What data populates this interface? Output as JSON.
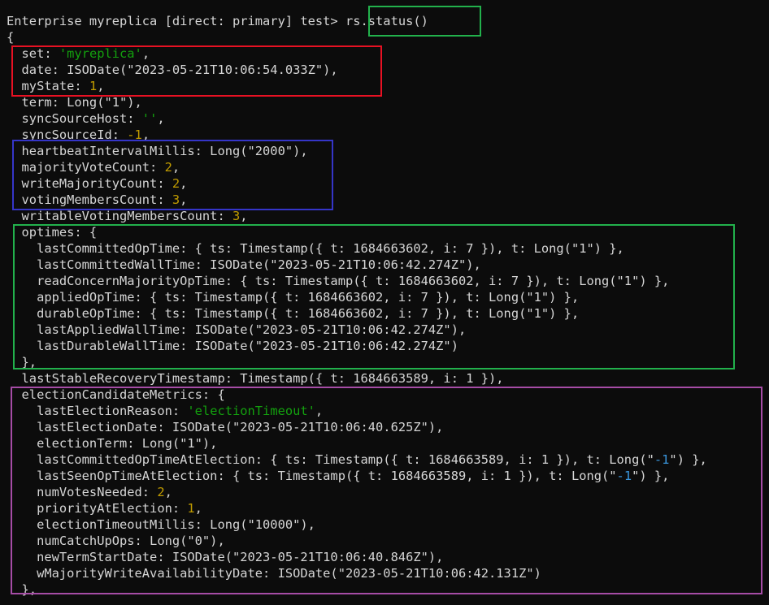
{
  "prompt": {
    "text": "Enterprise myreplica [direct: primary] test> ",
    "command": "rs.status()"
  },
  "highlight_colors": {
    "green": "#22b14c",
    "red": "#e81123",
    "blue": "#3535c8",
    "purple": "#a64ca6"
  },
  "output": {
    "open_brace": "{",
    "set_key": "  set: ",
    "set_val": "'myreplica'",
    "set_end": ",",
    "date": "  date: ISODate(\"2023-05-21T10:06:54.033Z\"),",
    "myState_key": "  myState: ",
    "myState_val": "1",
    "myState_end": ",",
    "term": "  term: Long(\"1\"),",
    "syncSourceHost_key": "  syncSourceHost: ",
    "syncSourceHost_val": "''",
    "syncSourceHost_end": ",",
    "syncSourceId_key": "  syncSourceId: ",
    "syncSourceId_val": "-1",
    "syncSourceId_end": ",",
    "heartbeat": "  heartbeatIntervalMillis: Long(\"2000\"),",
    "majorityVoteCount_key": "  majorityVoteCount: ",
    "majorityVoteCount_val": "2",
    "majorityVoteCount_end": ",",
    "writeMajorityCount_key": "  writeMajorityCount: ",
    "writeMajorityCount_val": "2",
    "writeMajorityCount_end": ",",
    "votingMembersCount_key": "  votingMembersCount: ",
    "votingMembersCount_val": "3",
    "votingMembersCount_end": ",",
    "writableVotingMembersCount_key": "  writableVotingMembersCount: ",
    "writableVotingMembersCount_val": "3",
    "writableVotingMembersCount_end": ",",
    "optimes_open": "  optimes: {",
    "optimes_lines": [
      "    lastCommittedOpTime: { ts: Timestamp({ t: 1684663602, i: 7 }), t: Long(\"1\") },",
      "    lastCommittedWallTime: ISODate(\"2023-05-21T10:06:42.274Z\"),",
      "    readConcernMajorityOpTime: { ts: Timestamp({ t: 1684663602, i: 7 }), t: Long(\"1\") },",
      "    appliedOpTime: { ts: Timestamp({ t: 1684663602, i: 7 }), t: Long(\"1\") },",
      "    durableOpTime: { ts: Timestamp({ t: 1684663602, i: 7 }), t: Long(\"1\") },",
      "    lastAppliedWallTime: ISODate(\"2023-05-21T10:06:42.274Z\"),",
      "    lastDurableWallTime: ISODate(\"2023-05-21T10:06:42.274Z\")"
    ],
    "optimes_close": "  },",
    "lastStableRecovery": "  lastStableRecoveryTimestamp: Timestamp({ t: 1684663589, i: 1 }),",
    "ecm_open": "  electionCandidateMetrics: {",
    "lastElectionReason_key": "    lastElectionReason: ",
    "lastElectionReason_val": "'electionTimeout'",
    "lastElectionReason_end": ",",
    "lastElectionDate": "    lastElectionDate: ISODate(\"2023-05-21T10:06:40.625Z\"),",
    "electionTerm": "    electionTerm: Long(\"1\"),",
    "lcote_a": "    lastCommittedOpTimeAtElection: { ts: Timestamp({ t: 1684663589, i: 1 }), t: Long(\"",
    "lcote_val": "-1",
    "lcote_b": "\") },",
    "lsote_a": "    lastSeenOpTimeAtElection: { ts: Timestamp({ t: 1684663589, i: 1 }), t: Long(\"",
    "lsote_val": "-1",
    "lsote_b": "\") },",
    "numVotesNeeded_key": "    numVotesNeeded: ",
    "numVotesNeeded_val": "2",
    "numVotesNeeded_end": ",",
    "priorityAtElection_key": "    priorityAtElection: ",
    "priorityAtElection_val": "1",
    "priorityAtElection_end": ",",
    "electionTimeoutMillis": "    electionTimeoutMillis: Long(\"10000\"),",
    "numCatchUpOps": "    numCatchUpOps: Long(\"0\"),",
    "newTermStartDate": "    newTermStartDate: ISODate(\"2023-05-21T10:06:40.846Z\"),",
    "wMajority": "    wMajorityWriteAvailabilityDate: ISODate(\"2023-05-21T10:06:42.131Z\")",
    "ecm_close": "  },"
  }
}
